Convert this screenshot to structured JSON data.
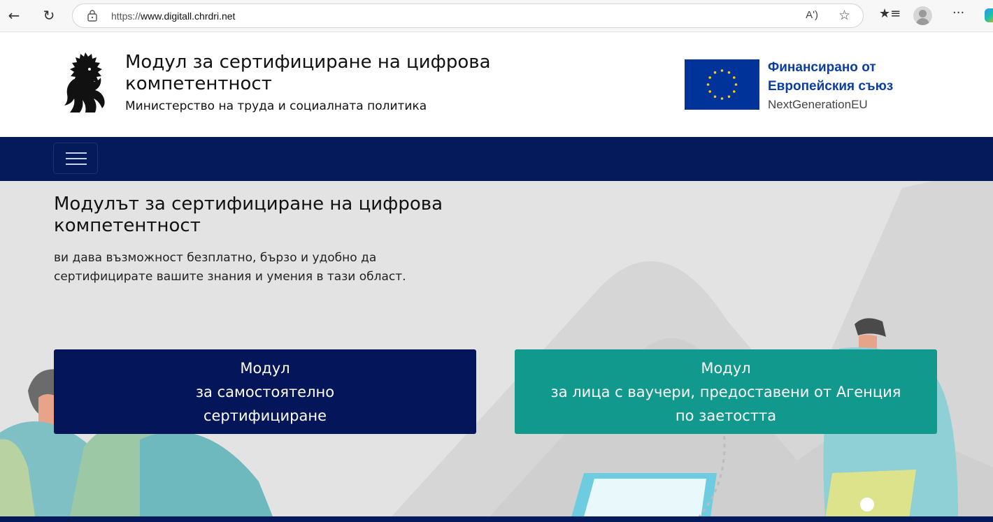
{
  "browser": {
    "url_prefix": "https://",
    "url_domain": "www.digitall.chrdri.net",
    "read_aloud_label": "Aʹ)",
    "more_label": "···"
  },
  "header": {
    "title": "Модул за сертифициране на цифрова компетентност",
    "subtitle": "Министерство на труда и социалната политика",
    "eu_line1": "Финансирано от",
    "eu_line2": "Европейския съюз",
    "eu_line3": "NextGenerationEU"
  },
  "hero": {
    "title": "Модулът за сертифициране на цифрова компетентност",
    "text": "ви дава възможност безплатно, бързо и удобно да сертифицирате вашите знания и умения в тази област."
  },
  "buttons": {
    "self": {
      "line1": "Модул",
      "line2": "за самостоятелно",
      "line3": "сертифициране"
    },
    "voucher": {
      "line1": "Модул",
      "line2": "за лица с ваучери, предоставени от Агенция",
      "line3": "по заетостта"
    }
  },
  "colors": {
    "navy": "#041a5a",
    "teal": "#10998c",
    "hero_bg": "#e3e3e3",
    "eu_blue": "#003399",
    "eu_star": "#ffcc00"
  }
}
